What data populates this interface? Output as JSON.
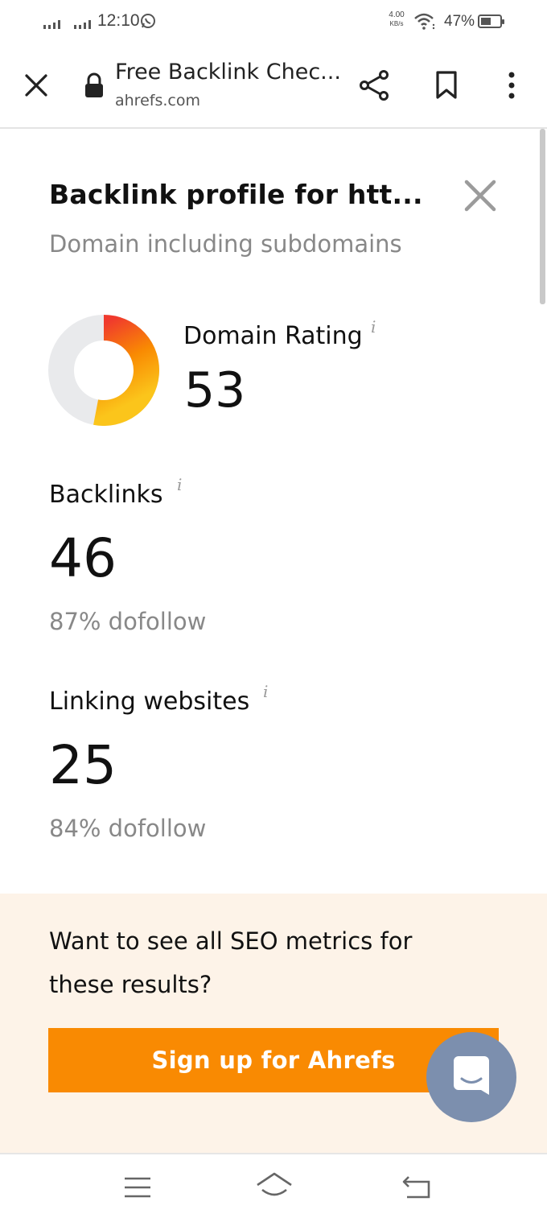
{
  "status_bar": {
    "time": "12:10",
    "net_speed_value": "4.00",
    "net_speed_unit": "KB/s",
    "battery": "47%"
  },
  "browser_bar": {
    "title": "Free Backlink Chec...",
    "url": "ahrefs.com"
  },
  "panel": {
    "title": "Backlink profile for htt...",
    "subtitle": "Domain including subdomains",
    "domain_rating": {
      "label": "Domain Rating",
      "info": "i",
      "value": "53",
      "gauge_fraction": 0.53,
      "gauge_colors": {
        "start": "#f03a2d",
        "mid": "#f98a02",
        "end": "#fbc51b",
        "track": "#e9eaec"
      }
    },
    "backlinks": {
      "label": "Backlinks",
      "info": "i",
      "value": "46",
      "dofollow": "87% dofollow"
    },
    "linking_websites": {
      "label": "Linking websites",
      "info": "i",
      "value": "25",
      "dofollow": "84% dofollow"
    }
  },
  "promo": {
    "line1": "Want to see all SEO metrics for",
    "line2": "these results?",
    "signup_label": "Sign up for Ahrefs",
    "accent": "#f98a02"
  }
}
